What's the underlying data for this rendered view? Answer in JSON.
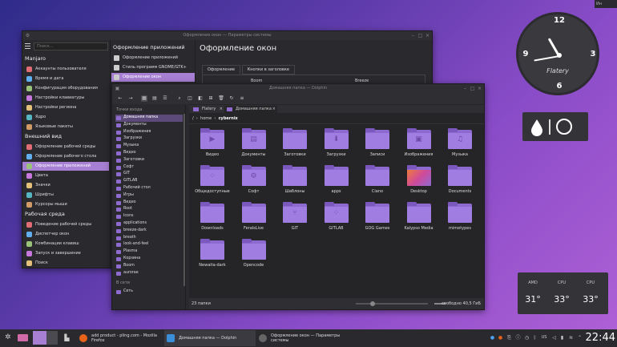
{
  "topright_label": "Ин",
  "clock": {
    "n12": "12",
    "n3": "3",
    "n6": "6",
    "n9": "9",
    "brand": "Flatery"
  },
  "sensors": [
    {
      "name": "AMD",
      "value": "31°"
    },
    {
      "name": "CPU",
      "value": "33°"
    },
    {
      "name": "CPU",
      "value": "33°"
    }
  ],
  "settings": {
    "title": "Оформление окон — Параметры системы",
    "search_placeholder": "Поиск...",
    "sections": [
      {
        "title": "Manjaro",
        "items": [
          "Аккаунты пользователя",
          "Время и дата",
          "Конфигурация оборудования",
          "Настройки клавиатуры",
          "Настройки региона",
          "Ядро",
          "Языковые пакеты"
        ]
      },
      {
        "title": "Внешний вид",
        "items": [
          "Оформление рабочей среды",
          "Оформление рабочего стола",
          "Оформление приложений",
          "Цвета",
          "Значки",
          "Шрифты",
          "Курсоры мыши"
        ]
      },
      {
        "title": "Рабочая среда",
        "items": [
          "Поведение рабочей среды",
          "Диспетчер окон",
          "Комбинации клавиш",
          "Запуск и завершение",
          "Поиск"
        ]
      }
    ],
    "selected_item": "Оформление приложений",
    "mid_title": "Оформление приложений",
    "mid_items": [
      "Оформление приложений",
      "Стиль программ GNOME/GTK+",
      "Оформление окон"
    ],
    "right_title": "Оформление окон",
    "tabs": [
      "Оформление",
      "Кнопки в заголовке"
    ],
    "themes": [
      "Boom",
      "Breeze"
    ]
  },
  "dolphin": {
    "title": "Домашняя папка — Dolphin",
    "places_header": "Точки входа",
    "places": [
      "Домашняя папка",
      "Документы",
      "Изображения",
      "Загрузки",
      "Музыка",
      "Видео",
      "Заготовки",
      "Софт",
      "GIT",
      "GITLAB",
      "Рабочий стол",
      "Игры",
      "Видео",
      "Root",
      "Icons",
      "applications",
      "breeze-dark",
      "breath",
      "look-and-feel",
      "Plasma",
      "Корзина",
      "Boom",
      "aurorae"
    ],
    "network_header": "В сети",
    "network": [
      "Сеть"
    ],
    "tabs": [
      "Flatery",
      "Домашняя папка"
    ],
    "breadcrumb": {
      "sep": "/",
      "home": "home",
      "current": "cybernix"
    },
    "files": [
      {
        "name": "Видео",
        "glyph": "▶"
      },
      {
        "name": "Документы",
        "glyph": "▤"
      },
      {
        "name": "Заготовки",
        "glyph": ""
      },
      {
        "name": "Загрузки",
        "glyph": "⬇"
      },
      {
        "name": "Записи",
        "glyph": ""
      },
      {
        "name": "Изображения",
        "glyph": "▣"
      },
      {
        "name": "Музыка",
        "glyph": "♫"
      },
      {
        "name": "Общедоступные",
        "glyph": "⁘"
      },
      {
        "name": "Софт",
        "glyph": "⚙"
      },
      {
        "name": "Шаблоны",
        "glyph": ""
      },
      {
        "name": "apps",
        "glyph": ""
      },
      {
        "name": "Ciano",
        "glyph": ""
      },
      {
        "name": "Desktop",
        "glyph": "",
        "desk": true
      },
      {
        "name": "Documents",
        "glyph": ""
      },
      {
        "name": "Downloads",
        "glyph": ""
      },
      {
        "name": "FeralsLive",
        "glyph": ""
      },
      {
        "name": "GIT",
        "glyph": "⑂"
      },
      {
        "name": "GITLAB",
        "glyph": "⁘"
      },
      {
        "name": "GOG Games",
        "glyph": ""
      },
      {
        "name": "Kalypso Media",
        "glyph": ""
      },
      {
        "name": "mimetypes",
        "glyph": ""
      },
      {
        "name": "Newaita-dark",
        "glyph": ""
      },
      {
        "name": "Opencode",
        "glyph": ""
      }
    ],
    "status_left": "23 папки",
    "status_right": "свободно 40,5 ГиБ"
  },
  "taskbar": {
    "tasks": [
      "add product - pling.com - Mozilla Firefox",
      "Домашняя папка — Dolphin",
      "Оформление окон — Параметры системы"
    ],
    "tray_lang": "US",
    "time": "22:44"
  }
}
